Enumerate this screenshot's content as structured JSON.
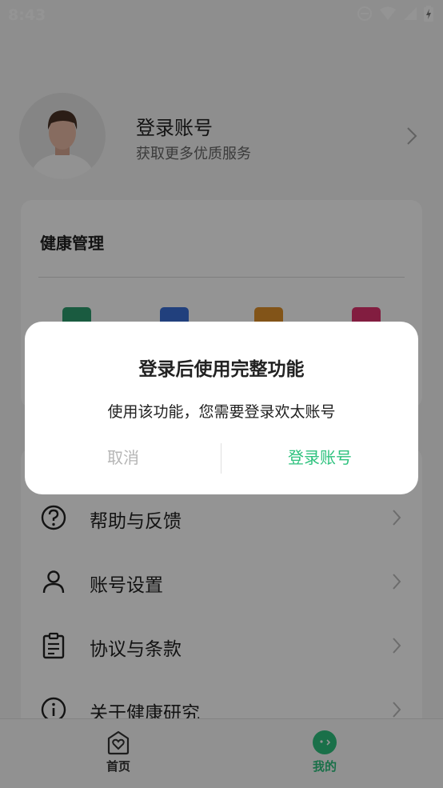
{
  "status_bar": {
    "time": "8:43"
  },
  "profile": {
    "title": "登录账号",
    "subtitle": "获取更多优质服务"
  },
  "health_card": {
    "title": "健康管理",
    "icons": [
      {
        "name": "briefcase-icon",
        "color": "#2e9e6e"
      },
      {
        "name": "tablet-icon",
        "color": "#3a6fd8"
      },
      {
        "name": "notebook-icon",
        "color": "#e0922a"
      },
      {
        "name": "pill-icon",
        "color": "#e0336e"
      }
    ]
  },
  "menu": {
    "items": [
      {
        "icon": "help-icon",
        "label": "帮助与反馈"
      },
      {
        "icon": "user-icon",
        "label": "账号设置"
      },
      {
        "icon": "clipboard-icon",
        "label": "协议与条款"
      },
      {
        "icon": "info-icon",
        "label": "关于健康研究"
      }
    ]
  },
  "bottom_nav": {
    "items": [
      {
        "icon": "home-heart-icon",
        "label": "首页",
        "active": false
      },
      {
        "icon": "mine-icon",
        "label": "我的",
        "active": true
      }
    ],
    "active_color": "#2ec27e",
    "inactive_color": "#333333"
  },
  "dialog": {
    "title": "登录后使用完整功能",
    "message": "使用该功能，您需要登录欢太账号",
    "cancel_label": "取消",
    "confirm_label": "登录账号"
  }
}
